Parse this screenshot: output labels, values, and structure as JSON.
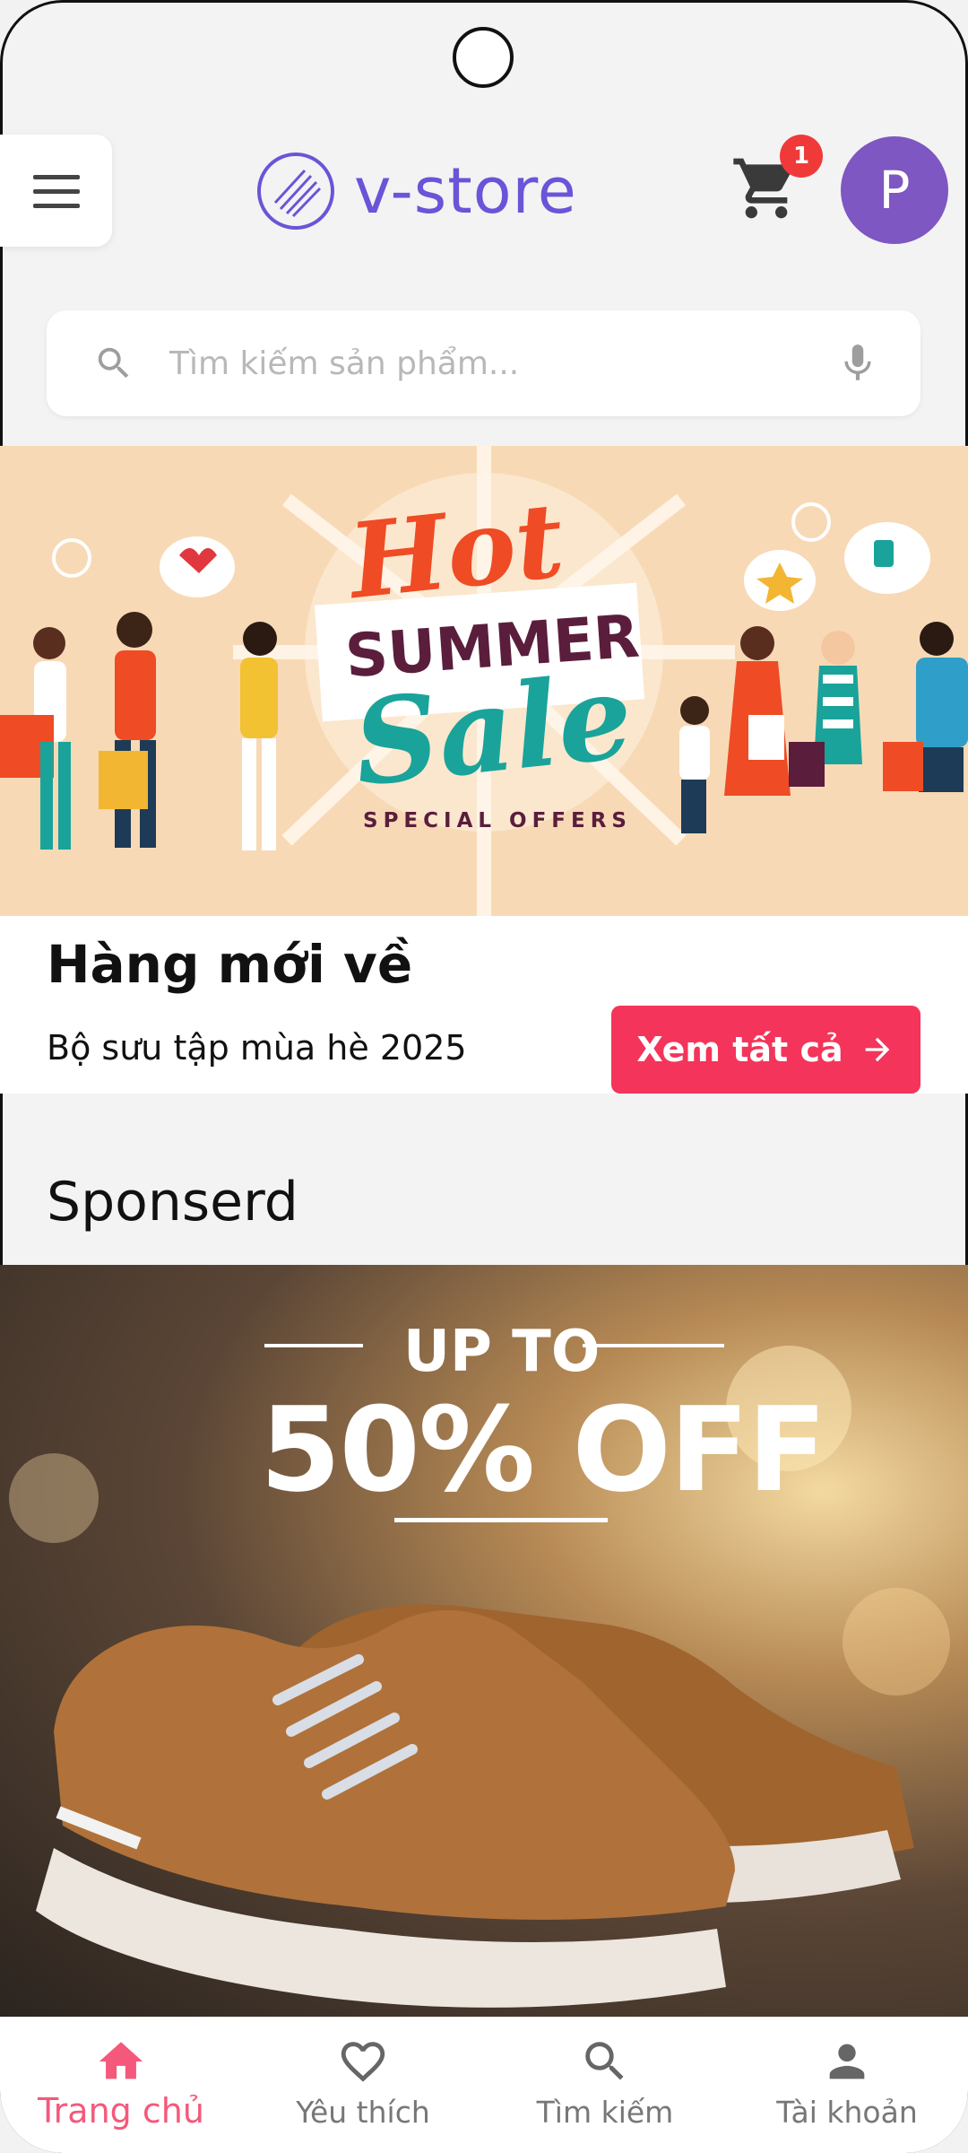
{
  "header": {
    "logo_text": "v-store",
    "cart_badge": "1",
    "avatar_initial": "P"
  },
  "search": {
    "placeholder": "Tìm kiếm sản phẩm..."
  },
  "hero_banner": {
    "hot": "Hot",
    "summer": "SUMMER",
    "sale": "Sale",
    "special": "SPECIAL OFFERS"
  },
  "arrivals": {
    "title": "Hàng mới về",
    "subtitle": "Bộ sưu tập mùa hè 2025",
    "see_all": "Xem tất cả"
  },
  "sponsored": {
    "title": "Sponserd",
    "promo_top": "UP TO",
    "promo_main": "50% OFF"
  },
  "bottom_nav": {
    "items": [
      {
        "label": "Trang chủ",
        "icon": "home-icon",
        "active": true
      },
      {
        "label": "Yêu thích",
        "icon": "heart-icon"
      },
      {
        "label": "Tìm kiếm",
        "icon": "search-icon"
      },
      {
        "label": "Tài khoản",
        "icon": "person-icon"
      }
    ]
  },
  "colors": {
    "brand": "#6a54d8",
    "accent": "#f4345a",
    "active_nav": "#f4597b",
    "avatar": "#7e57c2"
  }
}
